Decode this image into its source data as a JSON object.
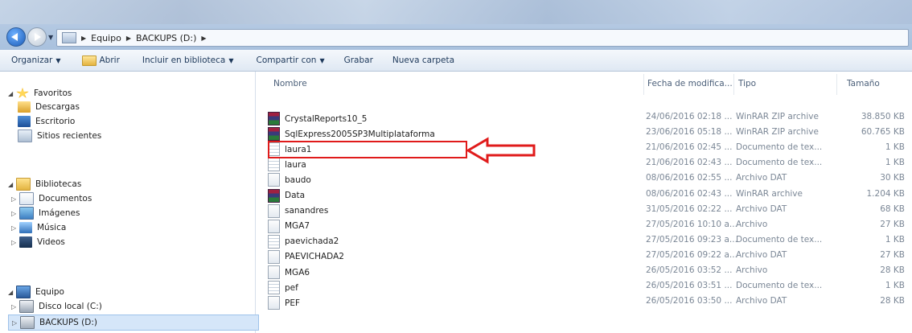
{
  "address": {
    "crumbs": [
      "Equipo",
      "BACKUPS (D:)"
    ]
  },
  "toolbar": {
    "organize": "Organizar",
    "open": "Abrir",
    "include": "Incluir en biblioteca",
    "share": "Compartir con",
    "burn": "Grabar",
    "new_folder": "Nueva carpeta"
  },
  "nav": {
    "favorites": "Favoritos",
    "downloads": "Descargas",
    "desktop": "Escritorio",
    "recent": "Sitios recientes",
    "libraries": "Bibliotecas",
    "documents": "Documentos",
    "images": "Imágenes",
    "music": "Música",
    "videos": "Videos",
    "computer": "Equipo",
    "local_disk": "Disco local (C:)",
    "backups": "BACKUPS (D:)"
  },
  "columns": {
    "name": "Nombre",
    "date": "Fecha de modifica...",
    "type": "Tipo",
    "size": "Tamaño"
  },
  "files": [
    {
      "name": "CrystalReports10_5",
      "date": "24/06/2016 02:18 ...",
      "type": "WinRAR ZIP archive",
      "size": "38.850 KB",
      "icon": "rar-icon"
    },
    {
      "name": "SqlExpress2005SP3Multiplataforma",
      "date": "23/06/2016 05:18 ...",
      "type": "WinRAR ZIP archive",
      "size": "60.765 KB",
      "icon": "rar-icon"
    },
    {
      "name": "laura1",
      "date": "21/06/2016 02:45 ...",
      "type": "Documento de tex...",
      "size": "1 KB",
      "icon": "txt-icon"
    },
    {
      "name": "laura",
      "date": "21/06/2016 02:43 ...",
      "type": "Documento de tex...",
      "size": "1 KB",
      "icon": "txt-icon"
    },
    {
      "name": "baudo",
      "date": "08/06/2016 02:55 ...",
      "type": "Archivo DAT",
      "size": "30 KB",
      "icon": "dat-icon"
    },
    {
      "name": "Data",
      "date": "08/06/2016 02:43 ...",
      "type": "WinRAR archive",
      "size": "1.204 KB",
      "icon": "rar-icon"
    },
    {
      "name": "sanandres",
      "date": "31/05/2016 02:22 ...",
      "type": "Archivo DAT",
      "size": "68 KB",
      "icon": "dat-icon"
    },
    {
      "name": "MGA7",
      "date": "27/05/2016 10:10 a...",
      "type": "Archivo",
      "size": "27 KB",
      "icon": "file-icon"
    },
    {
      "name": "paevichada2",
      "date": "27/05/2016 09:23 a...",
      "type": "Documento de tex...",
      "size": "1 KB",
      "icon": "txt-icon"
    },
    {
      "name": "PAEVICHADA2",
      "date": "27/05/2016 09:22 a...",
      "type": "Archivo DAT",
      "size": "27 KB",
      "icon": "dat-icon"
    },
    {
      "name": "MGA6",
      "date": "26/05/2016 03:52 ...",
      "type": "Archivo",
      "size": "28 KB",
      "icon": "file-icon"
    },
    {
      "name": "pef",
      "date": "26/05/2016 03:51 ...",
      "type": "Documento de tex...",
      "size": "1 KB",
      "icon": "txt-icon"
    },
    {
      "name": "PEF",
      "date": "26/05/2016 03:50 ...",
      "type": "Archivo DAT",
      "size": "28 KB",
      "icon": "dat-icon"
    }
  ],
  "colors": {
    "highlight": "#e01b1b",
    "selection": "#d5e6f9"
  }
}
